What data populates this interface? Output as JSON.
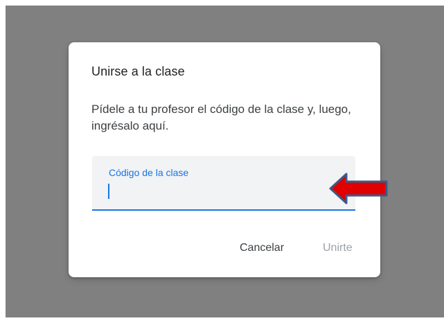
{
  "dialog": {
    "title": "Unirse a la clase",
    "instructions": "Pídele a tu profesor el código de la clase y, luego, ingrésalo aquí.",
    "code_field": {
      "label": "Código de la clase",
      "value": ""
    },
    "buttons": {
      "cancel": "Cancelar",
      "join": "Unirte"
    }
  },
  "colors": {
    "accent": "#1a73e8",
    "overlay": "#808080",
    "annotation_arrow_fill": "#e00000",
    "annotation_arrow_outline": "#3b5a8a",
    "disabled_text": "#9aa0a6"
  },
  "annotation": {
    "icon": "red-arrow-icon",
    "points_to": "code_field"
  }
}
